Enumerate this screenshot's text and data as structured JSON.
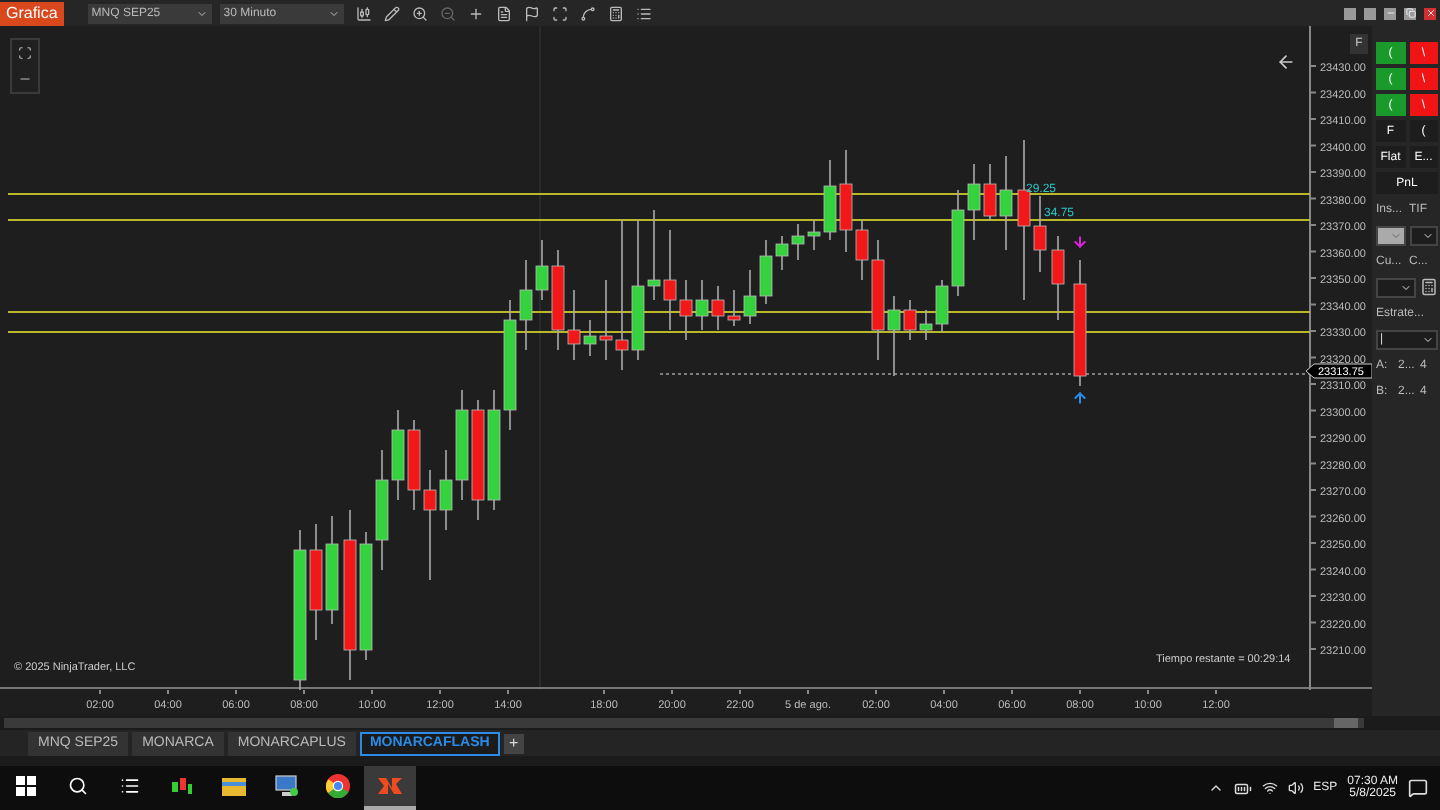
{
  "toolbar": {
    "title": "Grafica",
    "instrument": "MNQ SEP25",
    "interval": "30 Minuto"
  },
  "chart": {
    "price_labels": [
      "23430.00",
      "23420.00",
      "23410.00",
      "23400.00",
      "23390.00",
      "23380.00",
      "23370.00",
      "23360.00",
      "23350.00",
      "23340.00",
      "23330.00",
      "23320.00",
      "23310.00",
      "23300.00",
      "23290.00",
      "23280.00",
      "23270.00",
      "23260.00",
      "23250.00",
      "23240.00",
      "23230.00",
      "23220.00",
      "23210.00"
    ],
    "current_price": "23313.75",
    "time_labels": [
      "02:00",
      "04:00",
      "06:00",
      "08:00",
      "10:00",
      "12:00",
      "14:00",
      "18:00",
      "20:00",
      "22:00",
      "5 de ago.",
      "02:00",
      "04:00",
      "06:00",
      "08:00",
      "10:00",
      "12:00"
    ],
    "annotations": [
      {
        "text": "29.25"
      },
      {
        "text": "34.75"
      }
    ],
    "copyright": "© 2025 NinjaTrader, LLC",
    "timer": "Tiempo restante = 00:29:14",
    "axis_button": "F"
  },
  "trade_panel": {
    "rows": [
      [
        {
          "kind": "buy",
          "label": "("
        },
        {
          "kind": "sell",
          "label": "\\"
        }
      ],
      [
        {
          "kind": "buy",
          "label": "("
        },
        {
          "kind": "sell",
          "label": "\\"
        }
      ],
      [
        {
          "kind": "buy",
          "label": "("
        },
        {
          "kind": "sell",
          "label": "\\"
        }
      ],
      [
        {
          "kind": "plain",
          "label": "F"
        },
        {
          "kind": "plain",
          "label": "("
        }
      ],
      [
        {
          "kind": "plain",
          "label": "Flat"
        },
        {
          "kind": "plain",
          "label": "E..."
        }
      ],
      [
        {
          "kind": "plain",
          "label": "PnL"
        }
      ],
      [
        {
          "kind": "label",
          "label": "Ins..."
        },
        {
          "kind": "label",
          "label": "TIF"
        }
      ],
      [
        {
          "kind": "select",
          "disabled": true
        },
        {
          "kind": "select",
          "disabled": false
        }
      ],
      [
        {
          "kind": "label",
          "label": "Cu..."
        },
        {
          "kind": "label",
          "label": "C..."
        }
      ],
      [
        {
          "kind": "select",
          "disabled": false
        },
        {
          "kind": "icon"
        }
      ],
      [
        {
          "kind": "label",
          "label": "Estrate..."
        }
      ],
      [
        {
          "kind": "select",
          "disabled": false,
          "label": "|"
        }
      ],
      [
        {
          "kind": "label",
          "label": "A:"
        },
        {
          "kind": "label",
          "label": "2..."
        },
        {
          "kind": "label",
          "label": "4"
        }
      ],
      [
        {
          "kind": "label",
          "label": "B:"
        },
        {
          "kind": "label",
          "label": "2..."
        },
        {
          "kind": "label",
          "label": "4"
        }
      ]
    ]
  },
  "tabs": [
    {
      "label": "MNQ SEP25",
      "selected": false
    },
    {
      "label": "MONARCA",
      "selected": false
    },
    {
      "label": "MONARCAPLUS",
      "selected": false
    },
    {
      "label": "MONARCAFLASH",
      "selected": true
    }
  ],
  "add_tab": "+",
  "taskbar": {
    "apps": [
      {
        "kind": "trading",
        "selected": false
      },
      {
        "kind": "folder",
        "selected": false
      },
      {
        "kind": "computer",
        "selected": false
      },
      {
        "kind": "browser",
        "selected": false
      },
      {
        "kind": "ninja",
        "selected": true
      }
    ],
    "language": "ESP",
    "time": "07:30 AM",
    "date": "5/8/2025"
  }
}
